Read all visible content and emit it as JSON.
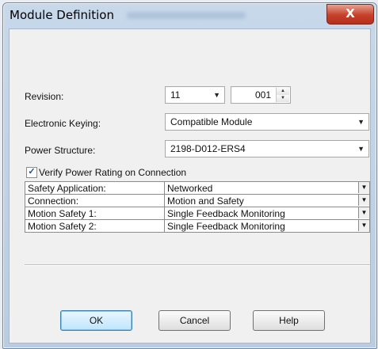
{
  "window": {
    "title": "Module Definition",
    "close_glyph": "X"
  },
  "fields": {
    "revision": {
      "label": "Revision:",
      "major": "11",
      "minor": "001"
    },
    "electronic_keying": {
      "label": "Electronic Keying:",
      "value": "Compatible Module"
    },
    "power_structure": {
      "label": "Power Structure:",
      "value": "2198-D012-ERS4"
    }
  },
  "verify_power_rating": {
    "label": "Verify Power Rating on Connection",
    "checked": true
  },
  "safety_grid": {
    "rows": [
      {
        "name": "Safety Application:",
        "value": "Networked"
      },
      {
        "name": "Connection:",
        "value": "Motion and Safety"
      },
      {
        "name": "Motion Safety 1:",
        "value": "Single Feedback Monitoring"
      },
      {
        "name": "Motion Safety 2:",
        "value": "Single Feedback Monitoring"
      }
    ]
  },
  "buttons": {
    "ok": "OK",
    "cancel": "Cancel",
    "help": "Help"
  },
  "icons": {
    "dropdown": "chevron-down-icon",
    "spin": "spin-up-down-icon",
    "check": "checkmark-icon"
  }
}
